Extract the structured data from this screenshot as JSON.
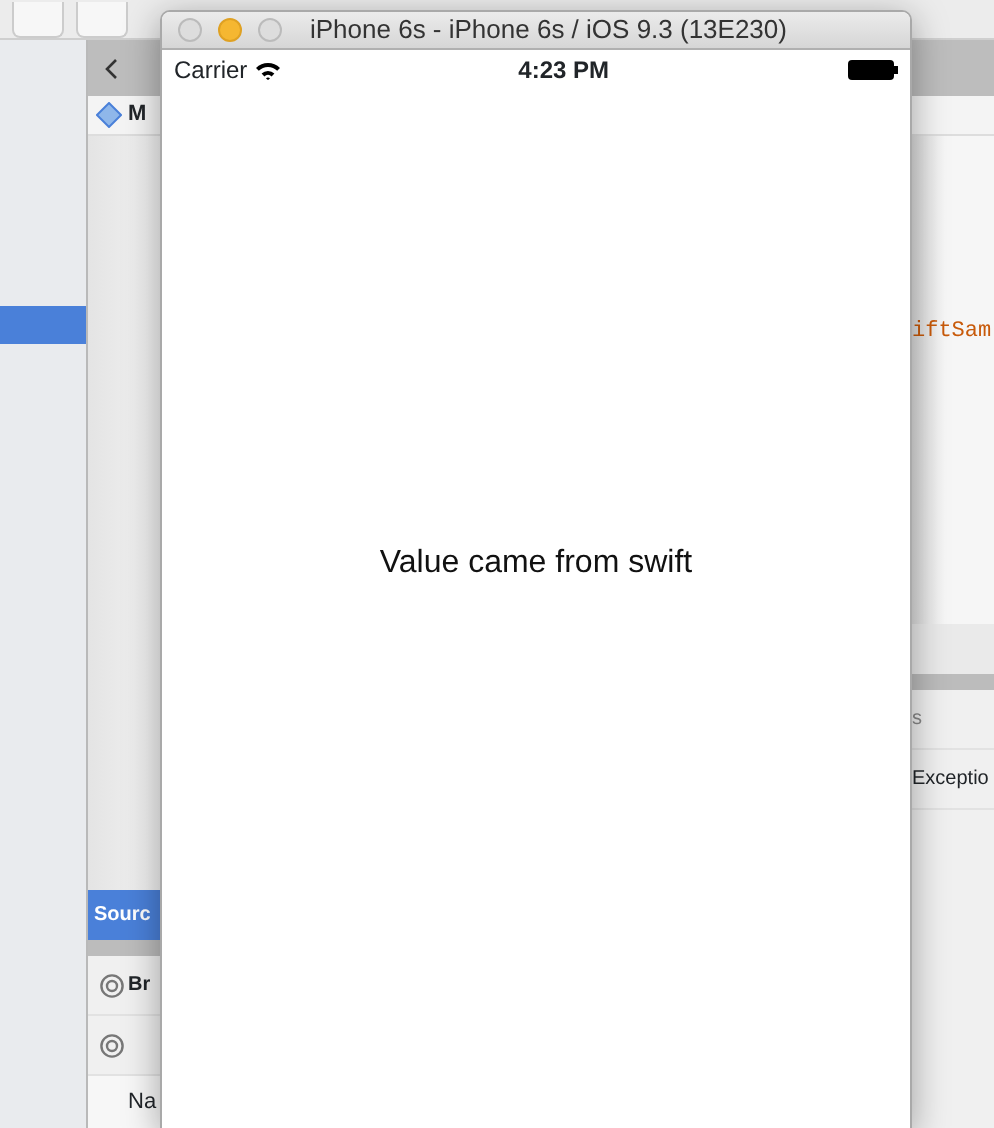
{
  "ide": {
    "breadcrumb": "M",
    "editor_text": "iftSam",
    "sidebar": {
      "rows": [
        {
          "selected": true
        }
      ]
    },
    "bottom_panel": {
      "header": "Sourc",
      "rows": [
        {
          "label": "Br"
        },
        {
          "label": ""
        }
      ],
      "column_header": "Na"
    },
    "right_panel": {
      "header": "s",
      "row": "Exceptio"
    }
  },
  "simulator": {
    "title": "iPhone 6s - iPhone 6s / iOS 9.3 (13E230)",
    "window_buttons": [
      {
        "kind": "close",
        "enabled": false
      },
      {
        "kind": "minimize",
        "enabled": true
      },
      {
        "kind": "zoom",
        "enabled": false
      }
    ],
    "status_bar": {
      "carrier": "Carrier",
      "time": "4:23 PM"
    },
    "label": "Value came from swift"
  }
}
